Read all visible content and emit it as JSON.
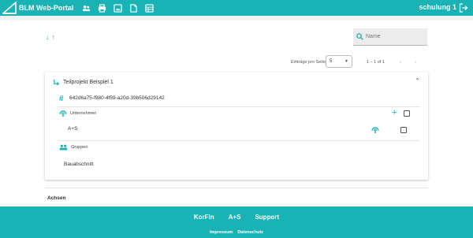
{
  "header": {
    "brand": "BLM Web-Portal",
    "nav_icons": [
      "users-icon",
      "printer-icon",
      "image-icon",
      "document-icon",
      "table-icon"
    ],
    "user": "schulung 1"
  },
  "list": {
    "search_placeholder": "Name",
    "per_page_label": "Einträge pro Seite",
    "per_page_value": "5",
    "range": "1 – 1 of 1"
  },
  "card": {
    "title": "Teilprojekt Beispiel 1",
    "uuid": "642d6a75-f980-4f59-a20d-39b506d29142",
    "companies_label": "Unternehmen",
    "companies": [
      "A+S"
    ],
    "groups_label": "Gruppen",
    "groups": [
      "Bauabschnitt"
    ]
  },
  "section_below": "Achsen",
  "footer": {
    "links": [
      "KorFin",
      "A+S",
      "Support"
    ],
    "legal": [
      "Impressum",
      "Datenschutz"
    ]
  },
  "colors": {
    "accent": "#1ab3b5"
  }
}
